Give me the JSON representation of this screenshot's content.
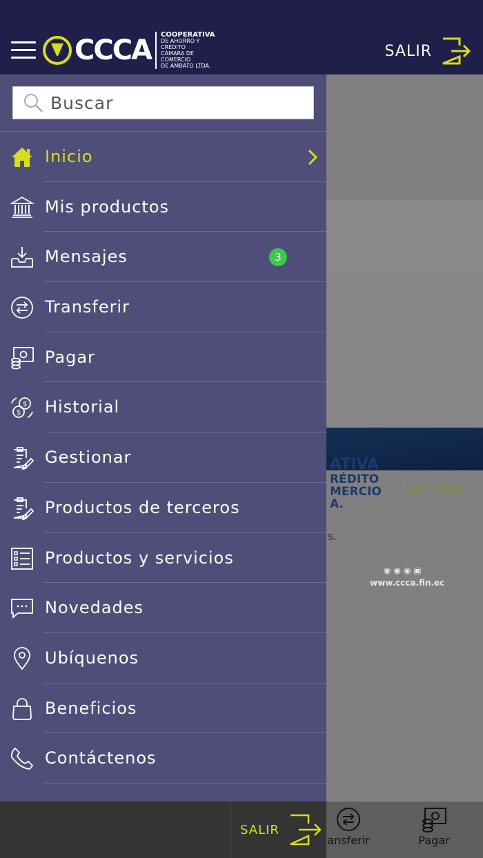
{
  "header": {
    "brand": "CCCA",
    "brand_sub_1": "COOPERATIVA",
    "brand_sub_2": "DE AHORRO Y CRÉDITO",
    "brand_sub_3": "CÁMARA DE COMERCIO",
    "brand_sub_4": "DE AMBATO LTDA.",
    "logout_label": "SALIR"
  },
  "colors": {
    "accent": "#d7de1f",
    "header_bg": "#201f4a",
    "drawer_bg": "#4e4e78",
    "badge": "#3ec94e"
  },
  "search": {
    "placeholder": "Buscar"
  },
  "menu": {
    "items": [
      {
        "label": "Inicio",
        "icon": "home-icon",
        "active": true
      },
      {
        "label": "Mis productos",
        "icon": "bank-icon"
      },
      {
        "label": "Mensajes",
        "icon": "inbox-icon",
        "badge": "3"
      },
      {
        "label": "Transferir",
        "icon": "transfer-icon"
      },
      {
        "label": "Pagar",
        "icon": "payment-icon"
      },
      {
        "label": "Historial",
        "icon": "history-icon"
      },
      {
        "label": "Gestionar",
        "icon": "clipboard-edit-icon"
      },
      {
        "label": "Productos de terceros",
        "icon": "clipboard-edit-icon"
      },
      {
        "label": "Productos y servicios",
        "icon": "list-icon"
      },
      {
        "label": "Novedades",
        "icon": "chat-icon"
      },
      {
        "label": "Ubíquenos",
        "icon": "location-pin-icon"
      },
      {
        "label": "Beneficios",
        "icon": "bag-icon"
      },
      {
        "label": "Contáctenos",
        "icon": "phone-icon"
      }
    ]
  },
  "drawer_footer": {
    "logout_label": "SALIR"
  },
  "background": {
    "banner_text_1": "ATIVA",
    "banner_text_2": "RÉDITO",
    "banner_text_3": "MERCIO",
    "banner_text_4": "A.",
    "banner_url": "www.ccca.fin.ec",
    "ver_mas": "Ver más",
    "fragment": "s."
  },
  "tabbar": {
    "tabs": [
      {
        "label": "ansferir",
        "icon": "transfer-icon"
      },
      {
        "label": "Pagar",
        "icon": "payment-icon"
      }
    ]
  }
}
